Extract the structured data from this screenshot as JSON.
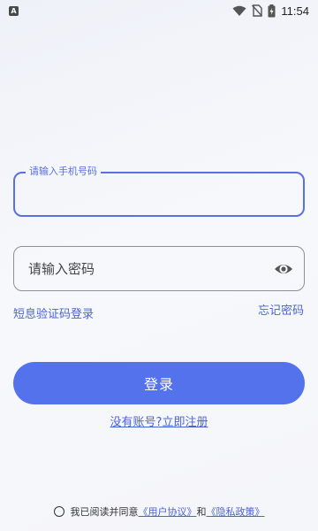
{
  "status_bar": {
    "notification_icon": "A",
    "time": "11:54",
    "icons": [
      "wifi-icon",
      "no-sim-icon",
      "battery-charging-icon"
    ]
  },
  "phone": {
    "label": "请输入手机号码",
    "value": ""
  },
  "password": {
    "placeholder": "请输入密码",
    "value": "",
    "toggle_icon": "eye-icon"
  },
  "links": {
    "sms_login": "短息验证码登录",
    "forgot_password": "忘记密码"
  },
  "login_button": "登录",
  "register_link": "没有账号?立即注册",
  "agreement": {
    "prefix": "我已阅读并同意",
    "user_agreement": "《用户协议》",
    "conjunction": "和",
    "privacy_policy": "《隐私政策》"
  },
  "colors": {
    "accent": "#5472ec",
    "link": "#4a63d8",
    "field_border_focused": "#5a70e0"
  }
}
